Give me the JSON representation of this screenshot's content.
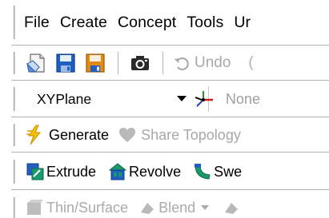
{
  "menubar": {
    "items": [
      "File",
      "Create",
      "Concept",
      "Tools",
      "Ur"
    ]
  },
  "toolbar_file": {
    "undo_label": "Undo",
    "redo_glyph": "("
  },
  "toolbar_plane": {
    "plane_selected": "XYPlane",
    "sketch_selected": "None"
  },
  "toolbar_generate": {
    "generate_label": "Generate",
    "share_topology_label": "Share Topology"
  },
  "toolbar_features": {
    "extrude_label": "Extrude",
    "revolve_label": "Revolve",
    "sweep_label": "Swe"
  },
  "toolbar_misc": {
    "thin_surface_label": "Thin/Surface",
    "blend_label": "Blend"
  },
  "colors": {
    "icon_blue": "#1f5fbf",
    "icon_green": "#1a9a6a",
    "icon_yellow": "#f4c400",
    "disabled_text": "#aaaaaa",
    "separator": "#b4b4b4"
  },
  "icons": [
    "new-document-icon",
    "save-icon",
    "save-as-icon",
    "screenshot-camera-icon",
    "undo-icon",
    "chevron-down-icon",
    "plane-triad-icon",
    "generate-lightning-icon",
    "share-topology-icon",
    "extrude-icon",
    "revolve-icon",
    "sweep-icon",
    "thin-surface-icon",
    "blend-icon"
  ]
}
